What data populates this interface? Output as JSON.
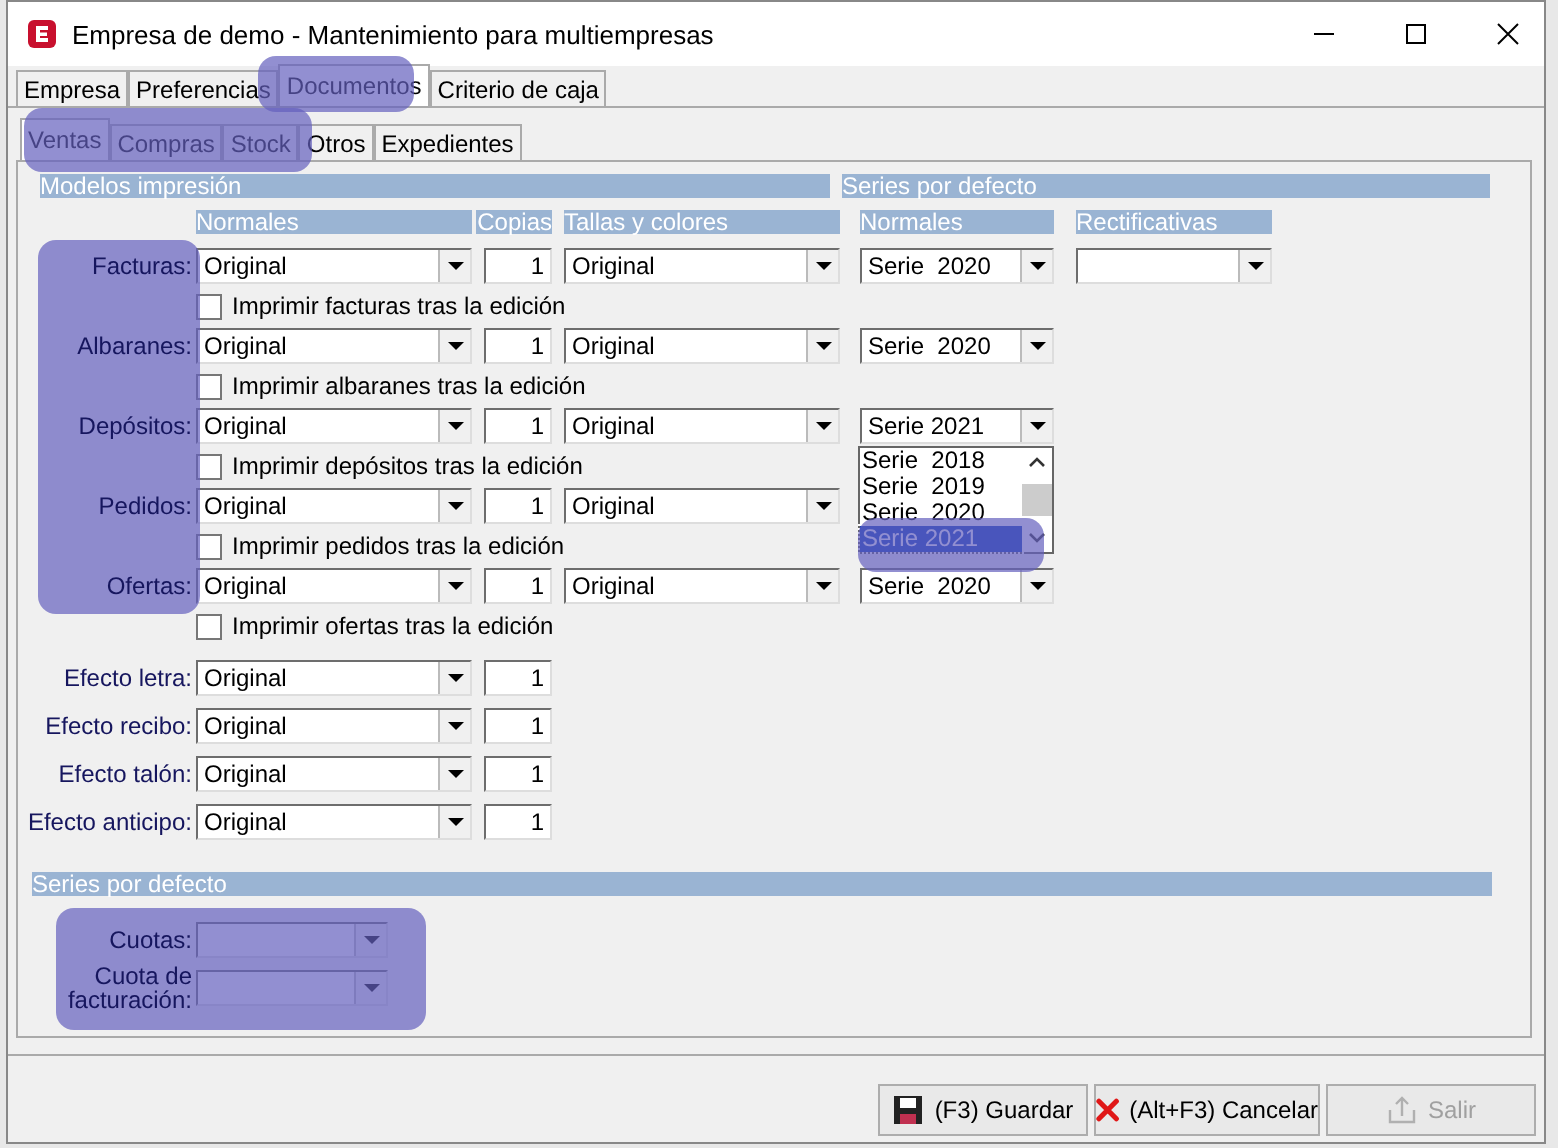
{
  "window": {
    "title": "Empresa de demo - Mantenimiento para multiempresas"
  },
  "tabs": [
    {
      "label": "Empresa",
      "selected": false
    },
    {
      "label": "Preferencias",
      "selected": false
    },
    {
      "label": "Documentos",
      "selected": true
    },
    {
      "label": "Criterio de caja",
      "selected": false
    }
  ],
  "subtabs": [
    {
      "label": "Ventas",
      "selected": true
    },
    {
      "label": "Compras",
      "selected": false
    },
    {
      "label": "Stock",
      "selected": false
    },
    {
      "label": "Otros",
      "selected": false
    },
    {
      "label": "Expedientes",
      "selected": false
    }
  ],
  "print_models": {
    "title": "Modelos impresión",
    "columns": {
      "normales": "Normales",
      "copias": "Copias",
      "tallas": "Tallas y colores"
    }
  },
  "default_series": {
    "title": "Series por defecto",
    "columns": {
      "normales": "Normales",
      "rectificativas": "Rectificativas"
    }
  },
  "documents": [
    {
      "label": "Facturas:",
      "model": "Original",
      "copies": "1",
      "tallas": "Original",
      "series": "Serie  2020",
      "has_rectificativas": true,
      "print_after": {
        "label": "Imprimir facturas tras la edición",
        "checked": false
      }
    },
    {
      "label": "Albaranes:",
      "model": "Original",
      "copies": "1",
      "tallas": "Original",
      "series": "Serie  2020",
      "has_rectificativas": false,
      "print_after": {
        "label": "Imprimir albaranes tras la edición",
        "checked": false
      }
    },
    {
      "label": "Depósitos:",
      "model": "Original",
      "copies": "1",
      "tallas": "Original",
      "series": "Serie 2021",
      "has_rectificativas": false,
      "open_list": [
        {
          "label": "Serie  2018",
          "selected": false
        },
        {
          "label": "Serie  2019",
          "selected": false
        },
        {
          "label": "Serie  2020",
          "selected": false
        },
        {
          "label": "Serie 2021",
          "selected": true
        }
      ],
      "print_after": {
        "label": "Imprimir depósitos tras la edición",
        "checked": false
      }
    },
    {
      "label": "Pedidos:",
      "model": "Original",
      "copies": "1",
      "tallas": "Original",
      "has_rectificativas": false,
      "print_after": {
        "label": "Imprimir pedidos tras la edición",
        "checked": false
      }
    },
    {
      "label": "Ofertas:",
      "model": "Original",
      "copies": "1",
      "tallas": "Original",
      "series": "Serie  2020",
      "has_rectificativas": false,
      "print_after": {
        "label": "Imprimir ofertas tras la edición",
        "checked": false
      }
    }
  ],
  "effects": [
    {
      "label": "Efecto letra:",
      "model": "Original",
      "copies": "1"
    },
    {
      "label": "Efecto recibo:",
      "model": "Original",
      "copies": "1"
    },
    {
      "label": "Efecto talón:",
      "model": "Original",
      "copies": "1"
    },
    {
      "label": "Efecto anticipo:",
      "model": "Original",
      "copies": "1"
    }
  ],
  "bottom_series": {
    "title": "Series por defecto",
    "fields": [
      {
        "label": "Cuotas:"
      },
      {
        "label": "Cuota de facturación:"
      }
    ]
  },
  "buttons": [
    {
      "kind": "save",
      "label": "(F3) Guardar",
      "disabled": false
    },
    {
      "kind": "cancel",
      "label": "(Alt+F3) Cancelar",
      "disabled": false
    },
    {
      "kind": "exit",
      "label": "Salir",
      "disabled": true
    }
  ]
}
